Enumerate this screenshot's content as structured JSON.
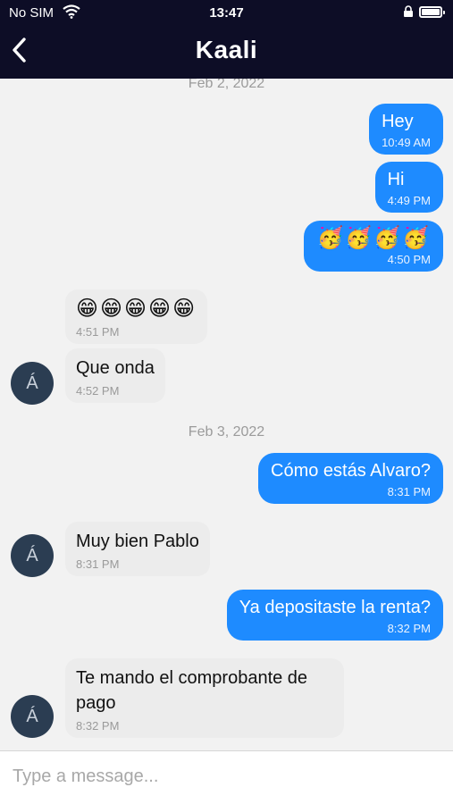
{
  "status_bar": {
    "carrier": "No SIM",
    "time": "13:47"
  },
  "header": {
    "title": "Kaali",
    "back_icon": "chevron-left-icon"
  },
  "avatar_initial": "Á",
  "dates": [
    "Feb 2, 2022",
    "Feb 3, 2022"
  ],
  "messages": [
    {
      "dir": "out",
      "text": "Hey",
      "time": "10:49 AM"
    },
    {
      "dir": "out",
      "text": "Hi",
      "time": "4:49 PM"
    },
    {
      "dir": "out",
      "text": "🥳🥳🥳🥳",
      "time": "4:50 PM"
    },
    {
      "dir": "in",
      "text": "😁😁😁😁😁",
      "time": "4:51 PM"
    },
    {
      "dir": "in",
      "text": "Que onda",
      "time": "4:52 PM"
    },
    {
      "dir": "out",
      "text": "Cómo estás Alvaro?",
      "time": "8:31 PM"
    },
    {
      "dir": "in",
      "text": "Muy bien Pablo",
      "time": "8:31 PM"
    },
    {
      "dir": "out",
      "text": "Ya depositaste la renta?",
      "time": "8:32 PM"
    },
    {
      "dir": "in",
      "text": "Te mando el comprobante de pago",
      "time": "8:32 PM"
    }
  ],
  "composer": {
    "placeholder": "Type a message..."
  },
  "colors": {
    "header_bg": "#0d0d26",
    "outgoing_bubble": "#1e8bff",
    "incoming_bubble": "#ececec",
    "avatar_bg": "#2b3d52"
  }
}
